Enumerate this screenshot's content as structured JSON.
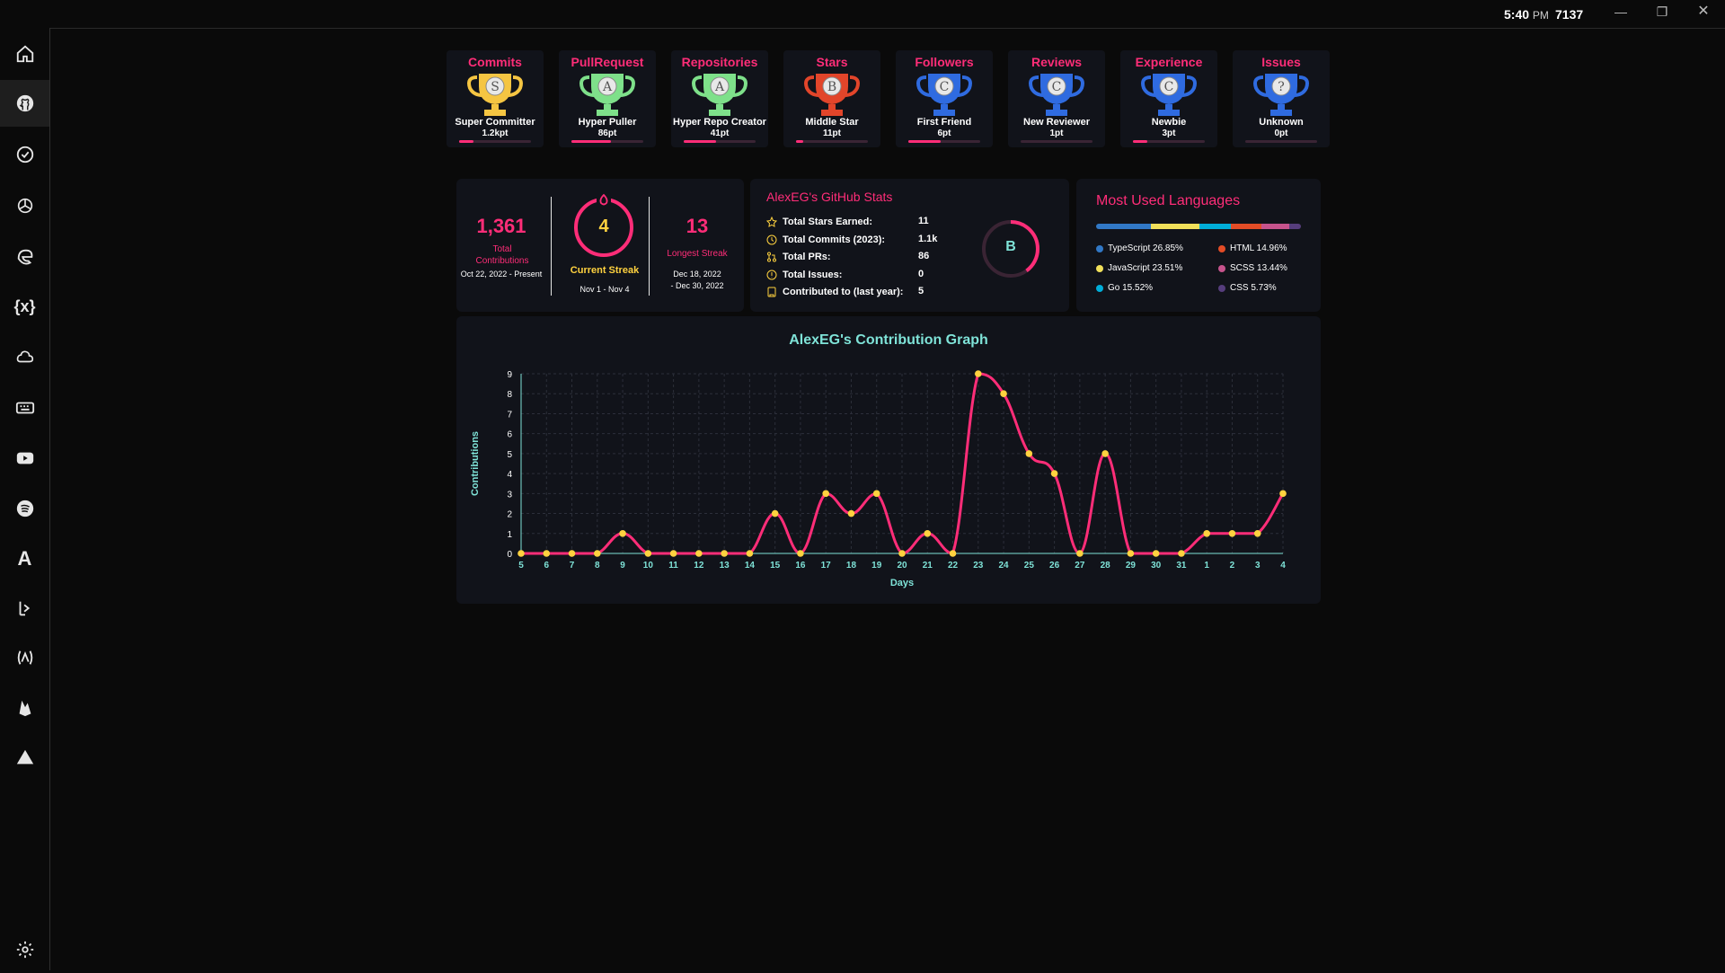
{
  "titlebar": {
    "time": "5:40",
    "ampm": "PM",
    "count": "7137"
  },
  "trophies": [
    {
      "category": "Commits",
      "rank": "S",
      "title": "Super Committer",
      "points": "1.2kpt",
      "progress": 0.2,
      "color": "#f5c542"
    },
    {
      "category": "PullRequest",
      "rank": "A",
      "title": "Hyper Puller",
      "points": "86pt",
      "progress": 0.55,
      "color": "#7ee08a"
    },
    {
      "category": "Repositories",
      "rank": "A",
      "title": "Hyper Repo Creator",
      "points": "41pt",
      "progress": 0.45,
      "color": "#7ee08a"
    },
    {
      "category": "Stars",
      "rank": "B",
      "title": "Middle Star",
      "points": "11pt",
      "progress": 0.1,
      "color": "#e2452a"
    },
    {
      "category": "Followers",
      "rank": "C",
      "title": "First Friend",
      "points": "6pt",
      "progress": 0.45,
      "color": "#2f6be0"
    },
    {
      "category": "Reviews",
      "rank": "C",
      "title": "New Reviewer",
      "points": "1pt",
      "progress": 0.0,
      "color": "#2f6be0"
    },
    {
      "category": "Experience",
      "rank": "C",
      "title": "Newbie",
      "points": "3pt",
      "progress": 0.2,
      "color": "#2f6be0"
    },
    {
      "category": "Issues",
      "rank": "?",
      "title": "Unknown",
      "points": "0pt",
      "progress": 0.0,
      "color": "#2f6be0"
    }
  ],
  "streak": {
    "total": "1,361",
    "total_label": "Total Contributions",
    "total_range": "Oct 22, 2022 - Present",
    "current": "4",
    "current_label": "Current Streak",
    "current_range": "Nov 1 - Nov 4",
    "longest": "13",
    "longest_label": "Longest Streak",
    "longest_range_1": "Dec 18, 2022",
    "longest_range_2": "- Dec 30, 2022"
  },
  "stats": {
    "title": "AlexEG's GitHub Stats",
    "rows": [
      {
        "label": "Total Stars Earned:",
        "value": "11",
        "icon": "star-icon"
      },
      {
        "label": "Total Commits (2023):",
        "value": "1.1k",
        "icon": "clock-icon"
      },
      {
        "label": "Total PRs:",
        "value": "86",
        "icon": "pull-request-icon"
      },
      {
        "label": "Total Issues:",
        "value": "0",
        "icon": "issue-icon"
      },
      {
        "label": "Contributed to (last year):",
        "value": "5",
        "icon": "repo-icon"
      }
    ],
    "grade": "B",
    "grade_progress": 0.4
  },
  "languages": {
    "title": "Most Used Languages",
    "items": [
      {
        "name": "TypeScript 26.85%",
        "percent": 26.85,
        "color": "#3178c6"
      },
      {
        "name": "JavaScript 23.51%",
        "percent": 23.51,
        "color": "#f1e05a"
      },
      {
        "name": "Go 15.52%",
        "percent": 15.52,
        "color": "#00add8"
      },
      {
        "name": "HTML 14.96%",
        "percent": 14.96,
        "color": "#e34c26"
      },
      {
        "name": "SCSS 13.44%",
        "percent": 13.44,
        "color": "#c6538c"
      },
      {
        "name": "CSS 5.73%",
        "percent": 5.73,
        "color": "#563d7c"
      }
    ]
  },
  "chart_data": {
    "type": "line",
    "title": "AlexEG's Contribution Graph",
    "xlabel": "Days",
    "ylabel": "Contributions",
    "categories": [
      "5",
      "6",
      "7",
      "8",
      "9",
      "10",
      "11",
      "12",
      "13",
      "14",
      "15",
      "16",
      "17",
      "18",
      "19",
      "20",
      "21",
      "22",
      "23",
      "24",
      "25",
      "26",
      "27",
      "28",
      "29",
      "30",
      "31",
      "1",
      "2",
      "3",
      "4"
    ],
    "values": [
      0,
      0,
      0,
      0,
      1,
      0,
      0,
      0,
      0,
      0,
      2,
      0,
      3,
      2,
      3,
      0,
      1,
      0,
      9,
      8,
      5,
      4,
      0,
      5,
      0,
      0,
      0,
      1,
      1,
      1,
      3
    ],
    "ylim": [
      0,
      9
    ],
    "yticks": [
      "0",
      "1",
      "2",
      "3",
      "4",
      "5",
      "6",
      "7",
      "8",
      "9"
    ],
    "grid": true,
    "line_color": "#ff2d78",
    "point_color": "#ffd23f"
  }
}
